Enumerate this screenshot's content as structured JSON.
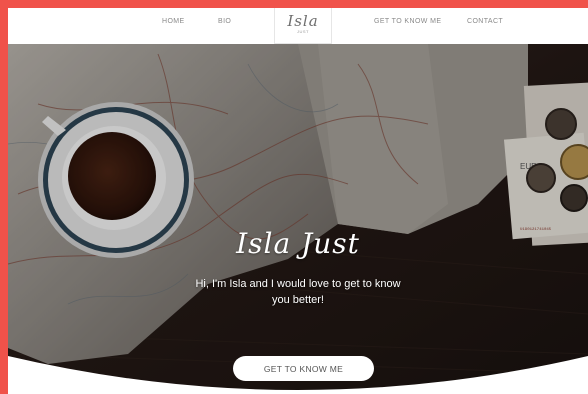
{
  "nav": {
    "items": [
      "HOME",
      "BIO",
      "GET TO KNOW ME",
      "CONTACT"
    ],
    "logo_script": "Isla",
    "logo_small": "JUST"
  },
  "hero": {
    "title": "Isla Just",
    "intro": "Hi, I'm Isla and I would love to get to know you better!",
    "cta_label": "GET TO KNOW ME"
  },
  "colors": {
    "border": "#f0524a",
    "background": "#ffffff",
    "hero_dark": "#2a1f1a",
    "button_text": "#555555"
  }
}
